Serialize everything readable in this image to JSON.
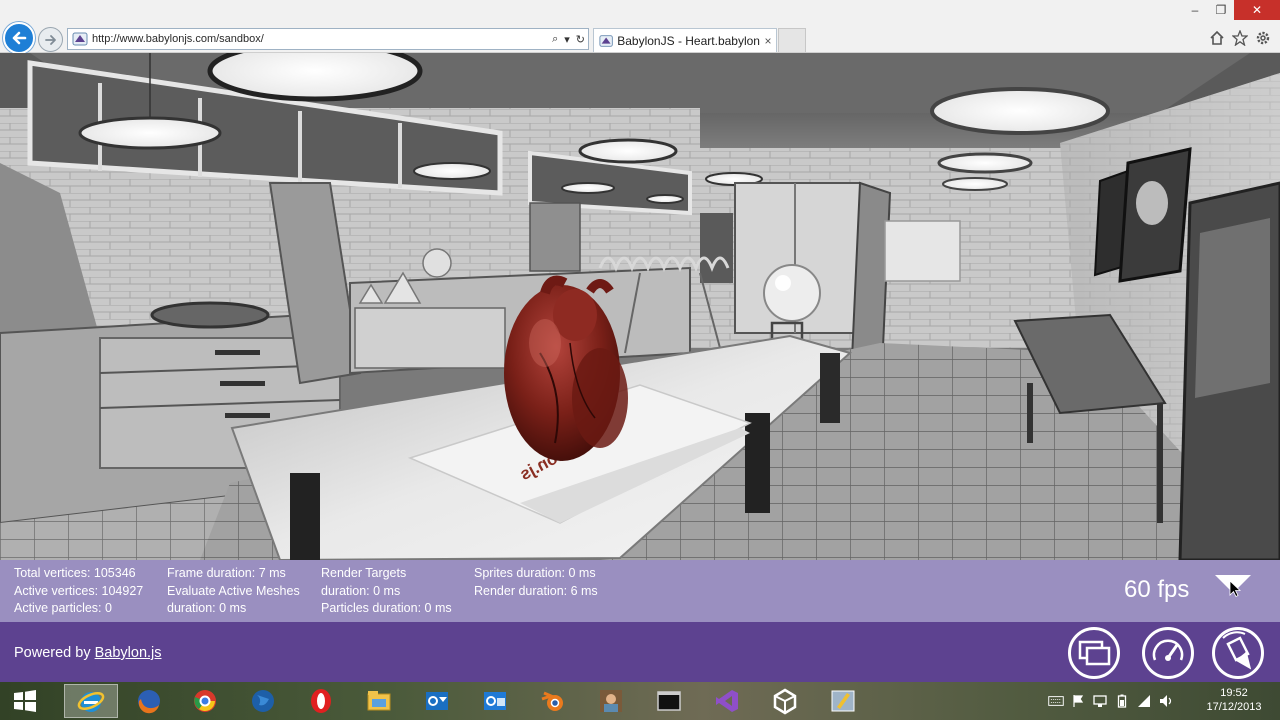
{
  "browser": {
    "url": "http://www.babylonjs.com/sandbox/",
    "tab_title": "BabylonJS - Heart.babylon",
    "tab_close": "×",
    "min_label": "–",
    "max_label": "❐",
    "close_label": "✕",
    "search_glyph": "⌕",
    "dropdown_glyph": "▾",
    "refresh_glyph": "↻",
    "icons": [
      "back-icon",
      "forward-icon",
      "home-icon",
      "star-icon",
      "gear-icon"
    ]
  },
  "scene": {
    "table_logo": "babylon.js"
  },
  "stats": {
    "col1": [
      "Total vertices: 105346",
      "Active vertices: 104927",
      "Active particles: 0"
    ],
    "col2": [
      "Frame duration: 7 ms",
      "Evaluate Active Meshes",
      "duration: 0 ms"
    ],
    "col3": [
      "Render Targets",
      "duration: 0 ms",
      "Particles duration: 0 ms"
    ],
    "col4": [
      "Sprites duration: 0 ms",
      "Render duration: 6 ms"
    ],
    "fps": "60 fps"
  },
  "footer": {
    "powered_prefix": "Powered by ",
    "powered_link": "Babylon.js",
    "buttons": [
      "fullscreen-icon",
      "performance-gauge-icon",
      "clear-scene-icon"
    ]
  },
  "taskbar": {
    "apps": [
      "windows-start-icon",
      "internet-explorer-icon",
      "firefox-icon",
      "chrome-icon",
      "globe-icon",
      "opera-icon",
      "file-explorer-icon",
      "outlook-icon",
      "outlook-alt-icon",
      "blender-icon",
      "photo-app-icon",
      "console-icon",
      "visual-studio-icon",
      "unity-icon",
      "photo-editor-icon"
    ],
    "time": "19:52",
    "date": "17/12/2013"
  },
  "colors": {
    "stats_bg": "#9a8fc0",
    "footer_bg": "#5d4290",
    "close_red": "#c7302a",
    "back_blue": "#1e7fd6"
  }
}
